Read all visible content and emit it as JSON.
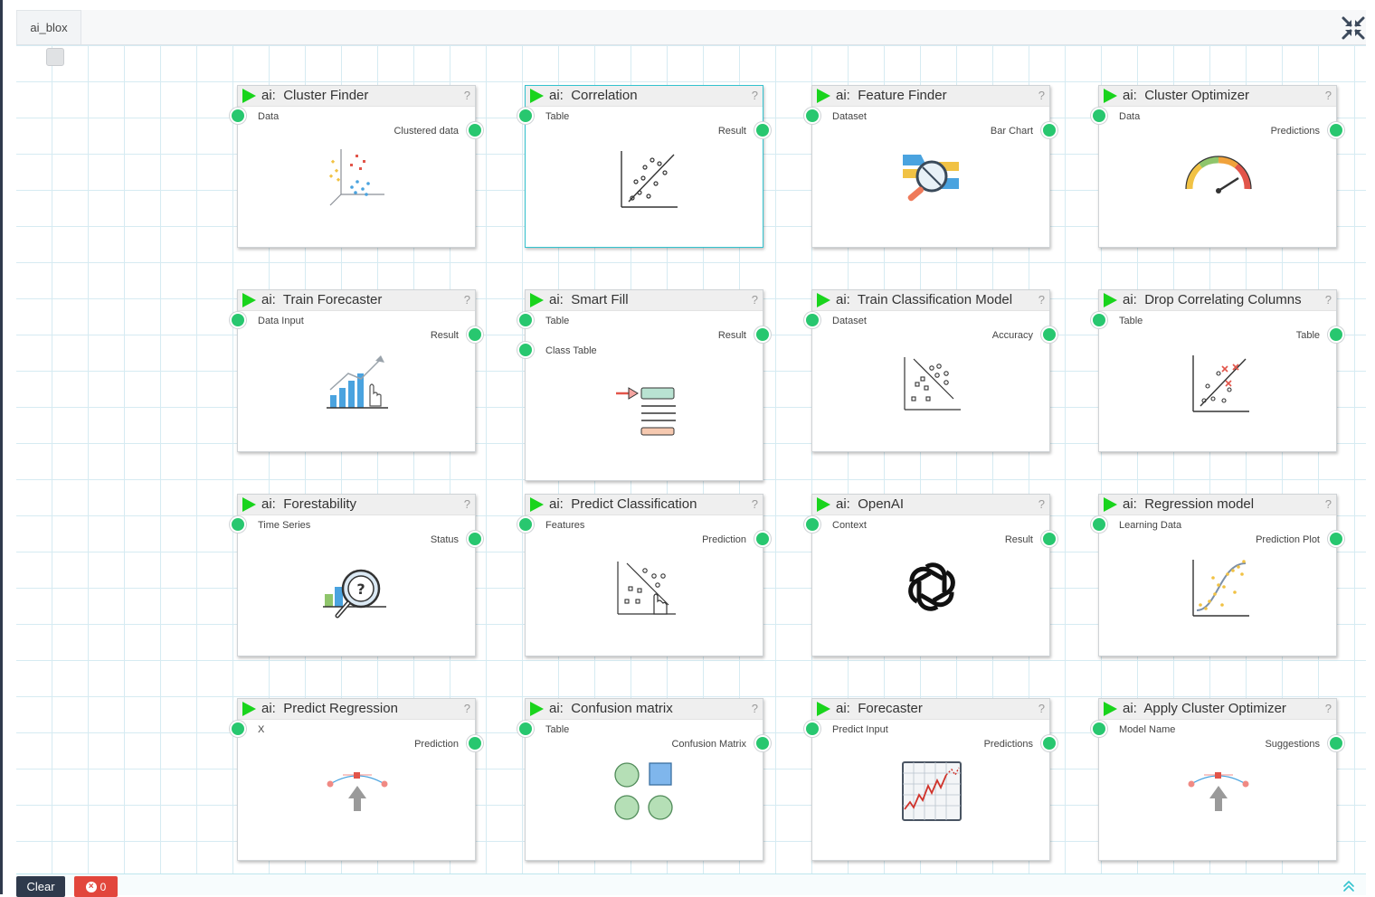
{
  "tab": {
    "label": "ai_blox"
  },
  "blocks": [
    {
      "name": "cluster-finder",
      "prefix": "ai:",
      "title": "Cluster Finder",
      "help": "?",
      "inputs": [
        "Data"
      ],
      "outputs": [
        "Clustered data"
      ],
      "icon": "cluster-scatter-icon",
      "selected": false
    },
    {
      "name": "correlation",
      "prefix": "ai:",
      "title": "Correlation",
      "help": "?",
      "inputs": [
        "Table"
      ],
      "outputs": [
        "Result"
      ],
      "icon": "correlation-scatter-icon",
      "selected": true
    },
    {
      "name": "feature-finder",
      "prefix": "ai:",
      "title": "Feature Finder",
      "help": "?",
      "inputs": [
        "Dataset"
      ],
      "outputs": [
        "Bar Chart"
      ],
      "icon": "feature-tools-icon",
      "selected": false
    },
    {
      "name": "cluster-optimizer",
      "prefix": "ai:",
      "title": "Cluster Optimizer",
      "help": "?",
      "inputs": [
        "Data"
      ],
      "outputs": [
        "Predictions"
      ],
      "icon": "gauge-icon",
      "selected": false
    },
    {
      "name": "train-forecaster",
      "prefix": "ai:",
      "title": "Train Forecaster",
      "help": "?",
      "inputs": [
        "Data Input"
      ],
      "outputs": [
        "Result"
      ],
      "icon": "growth-chart-icon",
      "selected": false
    },
    {
      "name": "smart-fill",
      "prefix": "ai:",
      "title": "Smart Fill",
      "help": "?",
      "inputs": [
        "Table",
        "Class Table"
      ],
      "outputs": [
        "Result"
      ],
      "icon": "fill-list-icon",
      "selected": false
    },
    {
      "name": "train-classification-model",
      "prefix": "ai:",
      "title": "Train Classification Model",
      "help": "?",
      "inputs": [
        "Dataset"
      ],
      "outputs": [
        "Accuracy"
      ],
      "icon": "classification-scatter-icon",
      "selected": false
    },
    {
      "name": "drop-correlating-columns",
      "prefix": "ai:",
      "title": "Drop Correlating Columns",
      "help": "?",
      "inputs": [
        "Table"
      ],
      "outputs": [
        "Table"
      ],
      "icon": "drop-scatter-icon",
      "selected": false
    },
    {
      "name": "forestability",
      "prefix": "ai:",
      "title": "Forestability",
      "help": "?",
      "inputs": [
        "Time Series"
      ],
      "outputs": [
        "Status"
      ],
      "icon": "magnifier-question-icon",
      "selected": false
    },
    {
      "name": "predict-classification",
      "prefix": "ai:",
      "title": "Predict Classification",
      "help": "?",
      "inputs": [
        "Features"
      ],
      "outputs": [
        "Prediction"
      ],
      "icon": "classification-pointer-icon",
      "selected": false
    },
    {
      "name": "openai",
      "prefix": "ai:",
      "title": "OpenAI",
      "help": "?",
      "inputs": [
        "Context"
      ],
      "outputs": [
        "Result"
      ],
      "icon": "openai-logo-icon",
      "selected": false
    },
    {
      "name": "regression-model",
      "prefix": "ai:",
      "title": "Regression model",
      "help": "?",
      "inputs": [
        "Learning Data"
      ],
      "outputs": [
        "Prediction Plot"
      ],
      "icon": "sigmoid-scatter-icon",
      "selected": false
    },
    {
      "name": "predict-regression",
      "prefix": "ai:",
      "title": "Predict Regression",
      "help": "?",
      "inputs": [
        "X"
      ],
      "outputs": [
        "Prediction"
      ],
      "icon": "curve-arrow-icon",
      "selected": false
    },
    {
      "name": "confusion-matrix",
      "prefix": "ai:",
      "title": "Confusion matrix",
      "help": "?",
      "inputs": [
        "Table"
      ],
      "outputs": [
        "Confusion Matrix"
      ],
      "icon": "shapes-matrix-icon",
      "selected": false
    },
    {
      "name": "forecaster",
      "prefix": "ai:",
      "title": "Forecaster",
      "help": "?",
      "inputs": [
        "Predict Input"
      ],
      "outputs": [
        "Predictions"
      ],
      "icon": "stock-chart-icon",
      "selected": false
    },
    {
      "name": "apply-cluster-optimizer",
      "prefix": "ai:",
      "title": "Apply Cluster Optimizer",
      "help": "?",
      "inputs": [
        "Model Name"
      ],
      "outputs": [
        "Suggestions"
      ],
      "icon": "curve-arrow-icon",
      "selected": false
    }
  ],
  "footer": {
    "clear_label": "Clear",
    "error_count": "0"
  },
  "colors": {
    "accent": "#19d41c",
    "port": "#28c76f",
    "selected_border": "#34c3cf",
    "error": "#e2463c",
    "dark": "#2f3a4c"
  }
}
